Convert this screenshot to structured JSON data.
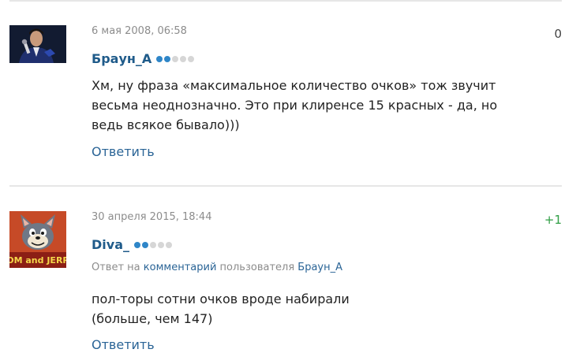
{
  "comments": [
    {
      "date": "6 мая 2008, 06:58",
      "score": "0",
      "author": "Браун_А",
      "rating_level": 2,
      "rating_max": 5,
      "text": "Хм, ну фраза «максимальное количество очков» тож звучит\nвесьма неоднозначно. Это при клиренсе 15 красных - да, но\nведь всякое бывало)))",
      "reply_label": "Ответить",
      "avatar_icon": "man-with-microphone-avatar"
    },
    {
      "date": "30 апреля 2015, 18:44",
      "score": "+1",
      "author": "Diva_",
      "rating_level": 2,
      "rating_max": 5,
      "reply_prefix": "Ответ на",
      "reply_link": "комментарий",
      "reply_middle": "пользователя",
      "reply_user": "Браун_А",
      "text": "пол-торы сотни очков вроде набирали\n(больше, чем 147)",
      "reply_label": "Ответить",
      "avatar_icon": "tom-and-jerry-cat-avatar",
      "avatar_caption": "TOM and JERRY"
    }
  ],
  "colors": {
    "link": "#2a6496",
    "author": "#1f5b8a",
    "rating_on": "#2f86c8",
    "rating_off": "#d6d6d6",
    "positive_score": "#2f9e44"
  }
}
